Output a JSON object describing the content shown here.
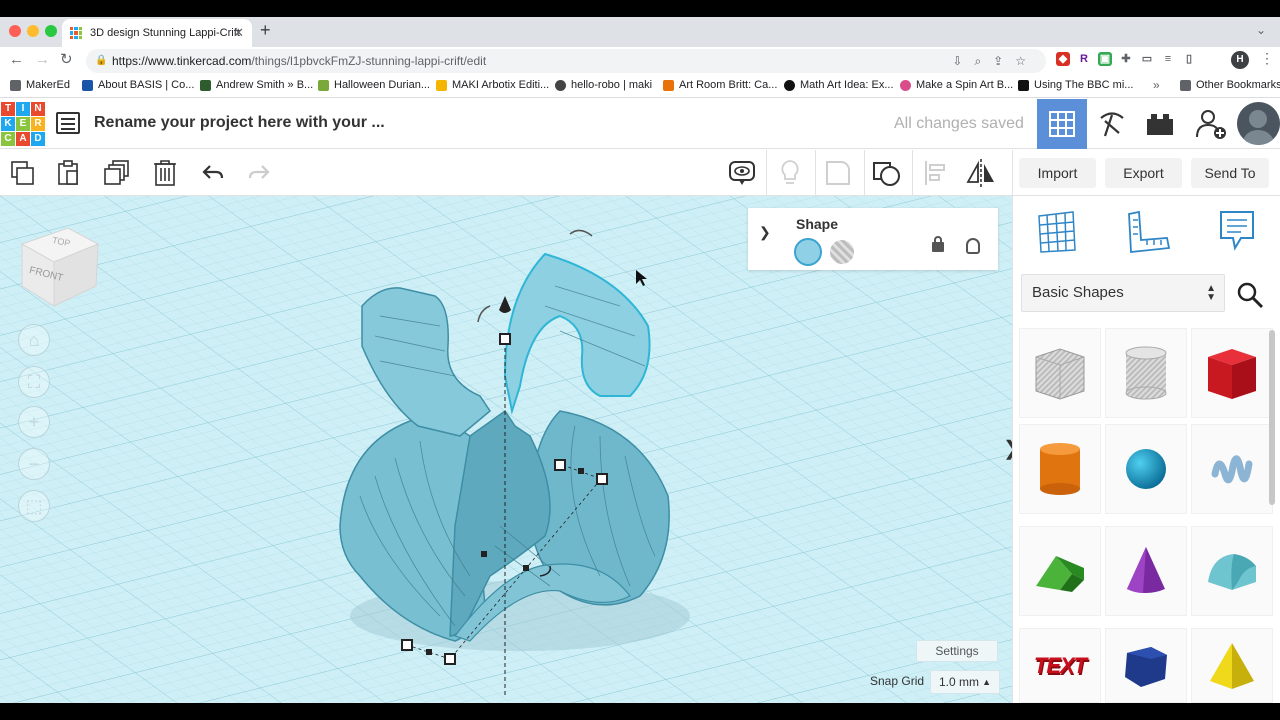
{
  "browser": {
    "tab_title": "3D design Stunning Lappi-Crift",
    "url_host": "https://www.tinkercad.com",
    "url_path": "/things/l1pbvckFmZJ-stunning-lappi-crift/edit",
    "profile_initial": "H",
    "bookmarks": [
      {
        "label": "MakerEd",
        "icon_color": "#5f6368"
      },
      {
        "label": "About BASIS | Co...",
        "icon_color": "#1a56a8"
      },
      {
        "label": "Andrew Smith » B...",
        "icon_color": "#2e5c2e"
      },
      {
        "label": "Halloween Durian...",
        "icon_color": "#7aa83a"
      },
      {
        "label": "MAKI Arbotix Editi...",
        "icon_color": "#f4b400"
      },
      {
        "label": "hello-robo | maki",
        "icon_color": "#444444"
      },
      {
        "label": "Art Room Britt: Ca...",
        "icon_color": "#e8710a"
      },
      {
        "label": "Math Art Idea: Ex...",
        "icon_color": "#111111"
      },
      {
        "label": "Make a Spin Art B...",
        "icon_color": "#d94d8a"
      },
      {
        "label": "Using The BBC mi...",
        "icon_color": "#111111"
      }
    ],
    "bookmarks_more": "»",
    "other_bookmarks": "Other Bookmarks"
  },
  "header": {
    "logo_letters": [
      "T",
      "I",
      "N",
      "K",
      "E",
      "R",
      "C",
      "A",
      "D"
    ],
    "project_name": "Rename your project here with your ...",
    "save_status": "All changes saved"
  },
  "toolbar": {
    "import_label": "Import",
    "export_label": "Export",
    "send_to_label": "Send To"
  },
  "viewcube": {
    "top": "TOP",
    "front": "FRONT"
  },
  "shape_panel": {
    "title": "Shape",
    "solid_color": "#8fd0e6"
  },
  "workplane": {
    "settings_label": "Settings",
    "snap_grid_label": "Snap Grid",
    "snap_grid_value": "1.0 mm"
  },
  "library": {
    "selected": "Basic Shapes",
    "shapes": [
      {
        "name": "Box hole"
      },
      {
        "name": "Cylinder hole"
      },
      {
        "name": "Box"
      },
      {
        "name": "Cylinder"
      },
      {
        "name": "Sphere"
      },
      {
        "name": "Scribble"
      },
      {
        "name": "Roof"
      },
      {
        "name": "Cone"
      },
      {
        "name": "Round Roof"
      },
      {
        "name": "Text",
        "label": "TEXT"
      },
      {
        "name": "Polygon"
      },
      {
        "name": "Pyramid"
      }
    ]
  },
  "colors": {
    "accent_blue": "#5b8fd8",
    "object_cyan": "#7ccbe0",
    "workplane": "#cfeff6"
  }
}
